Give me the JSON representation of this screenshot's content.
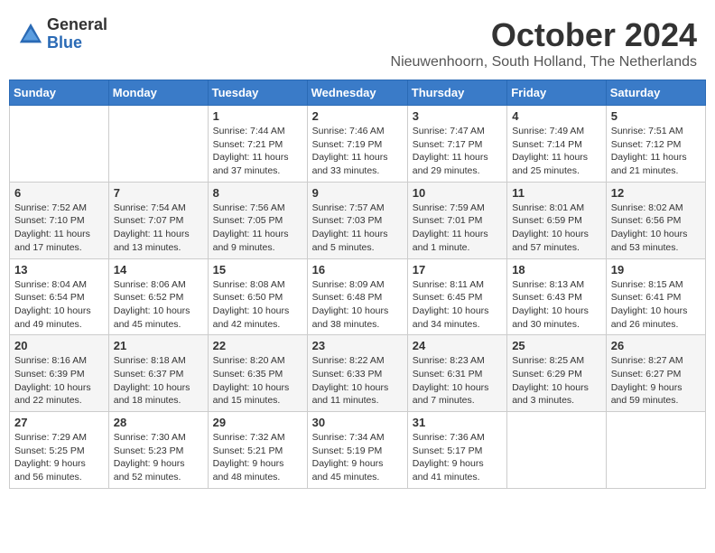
{
  "header": {
    "logo_general": "General",
    "logo_blue": "Blue",
    "month_title": "October 2024",
    "location": "Nieuwenhoorn, South Holland, The Netherlands"
  },
  "days_of_week": [
    "Sunday",
    "Monday",
    "Tuesday",
    "Wednesday",
    "Thursday",
    "Friday",
    "Saturday"
  ],
  "weeks": [
    [
      {
        "day": "",
        "info": ""
      },
      {
        "day": "",
        "info": ""
      },
      {
        "day": "1",
        "info": "Sunrise: 7:44 AM\nSunset: 7:21 PM\nDaylight: 11 hours\nand 37 minutes."
      },
      {
        "day": "2",
        "info": "Sunrise: 7:46 AM\nSunset: 7:19 PM\nDaylight: 11 hours\nand 33 minutes."
      },
      {
        "day": "3",
        "info": "Sunrise: 7:47 AM\nSunset: 7:17 PM\nDaylight: 11 hours\nand 29 minutes."
      },
      {
        "day": "4",
        "info": "Sunrise: 7:49 AM\nSunset: 7:14 PM\nDaylight: 11 hours\nand 25 minutes."
      },
      {
        "day": "5",
        "info": "Sunrise: 7:51 AM\nSunset: 7:12 PM\nDaylight: 11 hours\nand 21 minutes."
      }
    ],
    [
      {
        "day": "6",
        "info": "Sunrise: 7:52 AM\nSunset: 7:10 PM\nDaylight: 11 hours\nand 17 minutes."
      },
      {
        "day": "7",
        "info": "Sunrise: 7:54 AM\nSunset: 7:07 PM\nDaylight: 11 hours\nand 13 minutes."
      },
      {
        "day": "8",
        "info": "Sunrise: 7:56 AM\nSunset: 7:05 PM\nDaylight: 11 hours\nand 9 minutes."
      },
      {
        "day": "9",
        "info": "Sunrise: 7:57 AM\nSunset: 7:03 PM\nDaylight: 11 hours\nand 5 minutes."
      },
      {
        "day": "10",
        "info": "Sunrise: 7:59 AM\nSunset: 7:01 PM\nDaylight: 11 hours\nand 1 minute."
      },
      {
        "day": "11",
        "info": "Sunrise: 8:01 AM\nSunset: 6:59 PM\nDaylight: 10 hours\nand 57 minutes."
      },
      {
        "day": "12",
        "info": "Sunrise: 8:02 AM\nSunset: 6:56 PM\nDaylight: 10 hours\nand 53 minutes."
      }
    ],
    [
      {
        "day": "13",
        "info": "Sunrise: 8:04 AM\nSunset: 6:54 PM\nDaylight: 10 hours\nand 49 minutes."
      },
      {
        "day": "14",
        "info": "Sunrise: 8:06 AM\nSunset: 6:52 PM\nDaylight: 10 hours\nand 45 minutes."
      },
      {
        "day": "15",
        "info": "Sunrise: 8:08 AM\nSunset: 6:50 PM\nDaylight: 10 hours\nand 42 minutes."
      },
      {
        "day": "16",
        "info": "Sunrise: 8:09 AM\nSunset: 6:48 PM\nDaylight: 10 hours\nand 38 minutes."
      },
      {
        "day": "17",
        "info": "Sunrise: 8:11 AM\nSunset: 6:45 PM\nDaylight: 10 hours\nand 34 minutes."
      },
      {
        "day": "18",
        "info": "Sunrise: 8:13 AM\nSunset: 6:43 PM\nDaylight: 10 hours\nand 30 minutes."
      },
      {
        "day": "19",
        "info": "Sunrise: 8:15 AM\nSunset: 6:41 PM\nDaylight: 10 hours\nand 26 minutes."
      }
    ],
    [
      {
        "day": "20",
        "info": "Sunrise: 8:16 AM\nSunset: 6:39 PM\nDaylight: 10 hours\nand 22 minutes."
      },
      {
        "day": "21",
        "info": "Sunrise: 8:18 AM\nSunset: 6:37 PM\nDaylight: 10 hours\nand 18 minutes."
      },
      {
        "day": "22",
        "info": "Sunrise: 8:20 AM\nSunset: 6:35 PM\nDaylight: 10 hours\nand 15 minutes."
      },
      {
        "day": "23",
        "info": "Sunrise: 8:22 AM\nSunset: 6:33 PM\nDaylight: 10 hours\nand 11 minutes."
      },
      {
        "day": "24",
        "info": "Sunrise: 8:23 AM\nSunset: 6:31 PM\nDaylight: 10 hours\nand 7 minutes."
      },
      {
        "day": "25",
        "info": "Sunrise: 8:25 AM\nSunset: 6:29 PM\nDaylight: 10 hours\nand 3 minutes."
      },
      {
        "day": "26",
        "info": "Sunrise: 8:27 AM\nSunset: 6:27 PM\nDaylight: 9 hours\nand 59 minutes."
      }
    ],
    [
      {
        "day": "27",
        "info": "Sunrise: 7:29 AM\nSunset: 5:25 PM\nDaylight: 9 hours\nand 56 minutes."
      },
      {
        "day": "28",
        "info": "Sunrise: 7:30 AM\nSunset: 5:23 PM\nDaylight: 9 hours\nand 52 minutes."
      },
      {
        "day": "29",
        "info": "Sunrise: 7:32 AM\nSunset: 5:21 PM\nDaylight: 9 hours\nand 48 minutes."
      },
      {
        "day": "30",
        "info": "Sunrise: 7:34 AM\nSunset: 5:19 PM\nDaylight: 9 hours\nand 45 minutes."
      },
      {
        "day": "31",
        "info": "Sunrise: 7:36 AM\nSunset: 5:17 PM\nDaylight: 9 hours\nand 41 minutes."
      },
      {
        "day": "",
        "info": ""
      },
      {
        "day": "",
        "info": ""
      }
    ]
  ]
}
